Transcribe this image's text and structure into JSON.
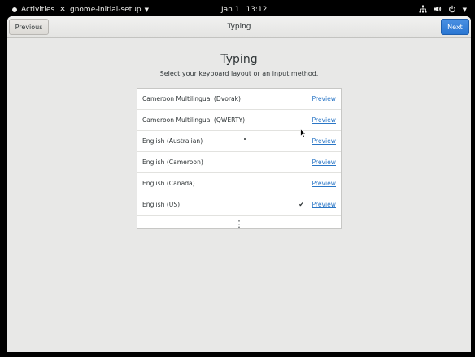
{
  "topbar": {
    "activities": "Activities",
    "app_name": "gnome-initial-setup",
    "date": "Jan 1",
    "time": "13:12",
    "status_icons": [
      "network-icon",
      "volume-icon",
      "power-icon"
    ]
  },
  "window": {
    "title": "Typing",
    "previous_label": "Previous",
    "next_label": "Next"
  },
  "page": {
    "heading": "Typing",
    "subheading": "Select your keyboard layout or an input method."
  },
  "layouts": [
    {
      "name": "Cameroon Multilingual (Dvorak)",
      "preview": "Preview",
      "selected": false
    },
    {
      "name": "Cameroon Multilingual (QWERTY)",
      "preview": "Preview",
      "selected": false
    },
    {
      "name": "English (Australian)",
      "preview": "Preview",
      "selected": false
    },
    {
      "name": "English (Cameroon)",
      "preview": "Preview",
      "selected": false
    },
    {
      "name": "English (Canada)",
      "preview": "Preview",
      "selected": false
    },
    {
      "name": "English (US)",
      "preview": "Preview",
      "selected": true
    }
  ],
  "colors": {
    "accent": "#2a76d2",
    "link": "#2a76c6",
    "background": "#e8e8e7"
  }
}
